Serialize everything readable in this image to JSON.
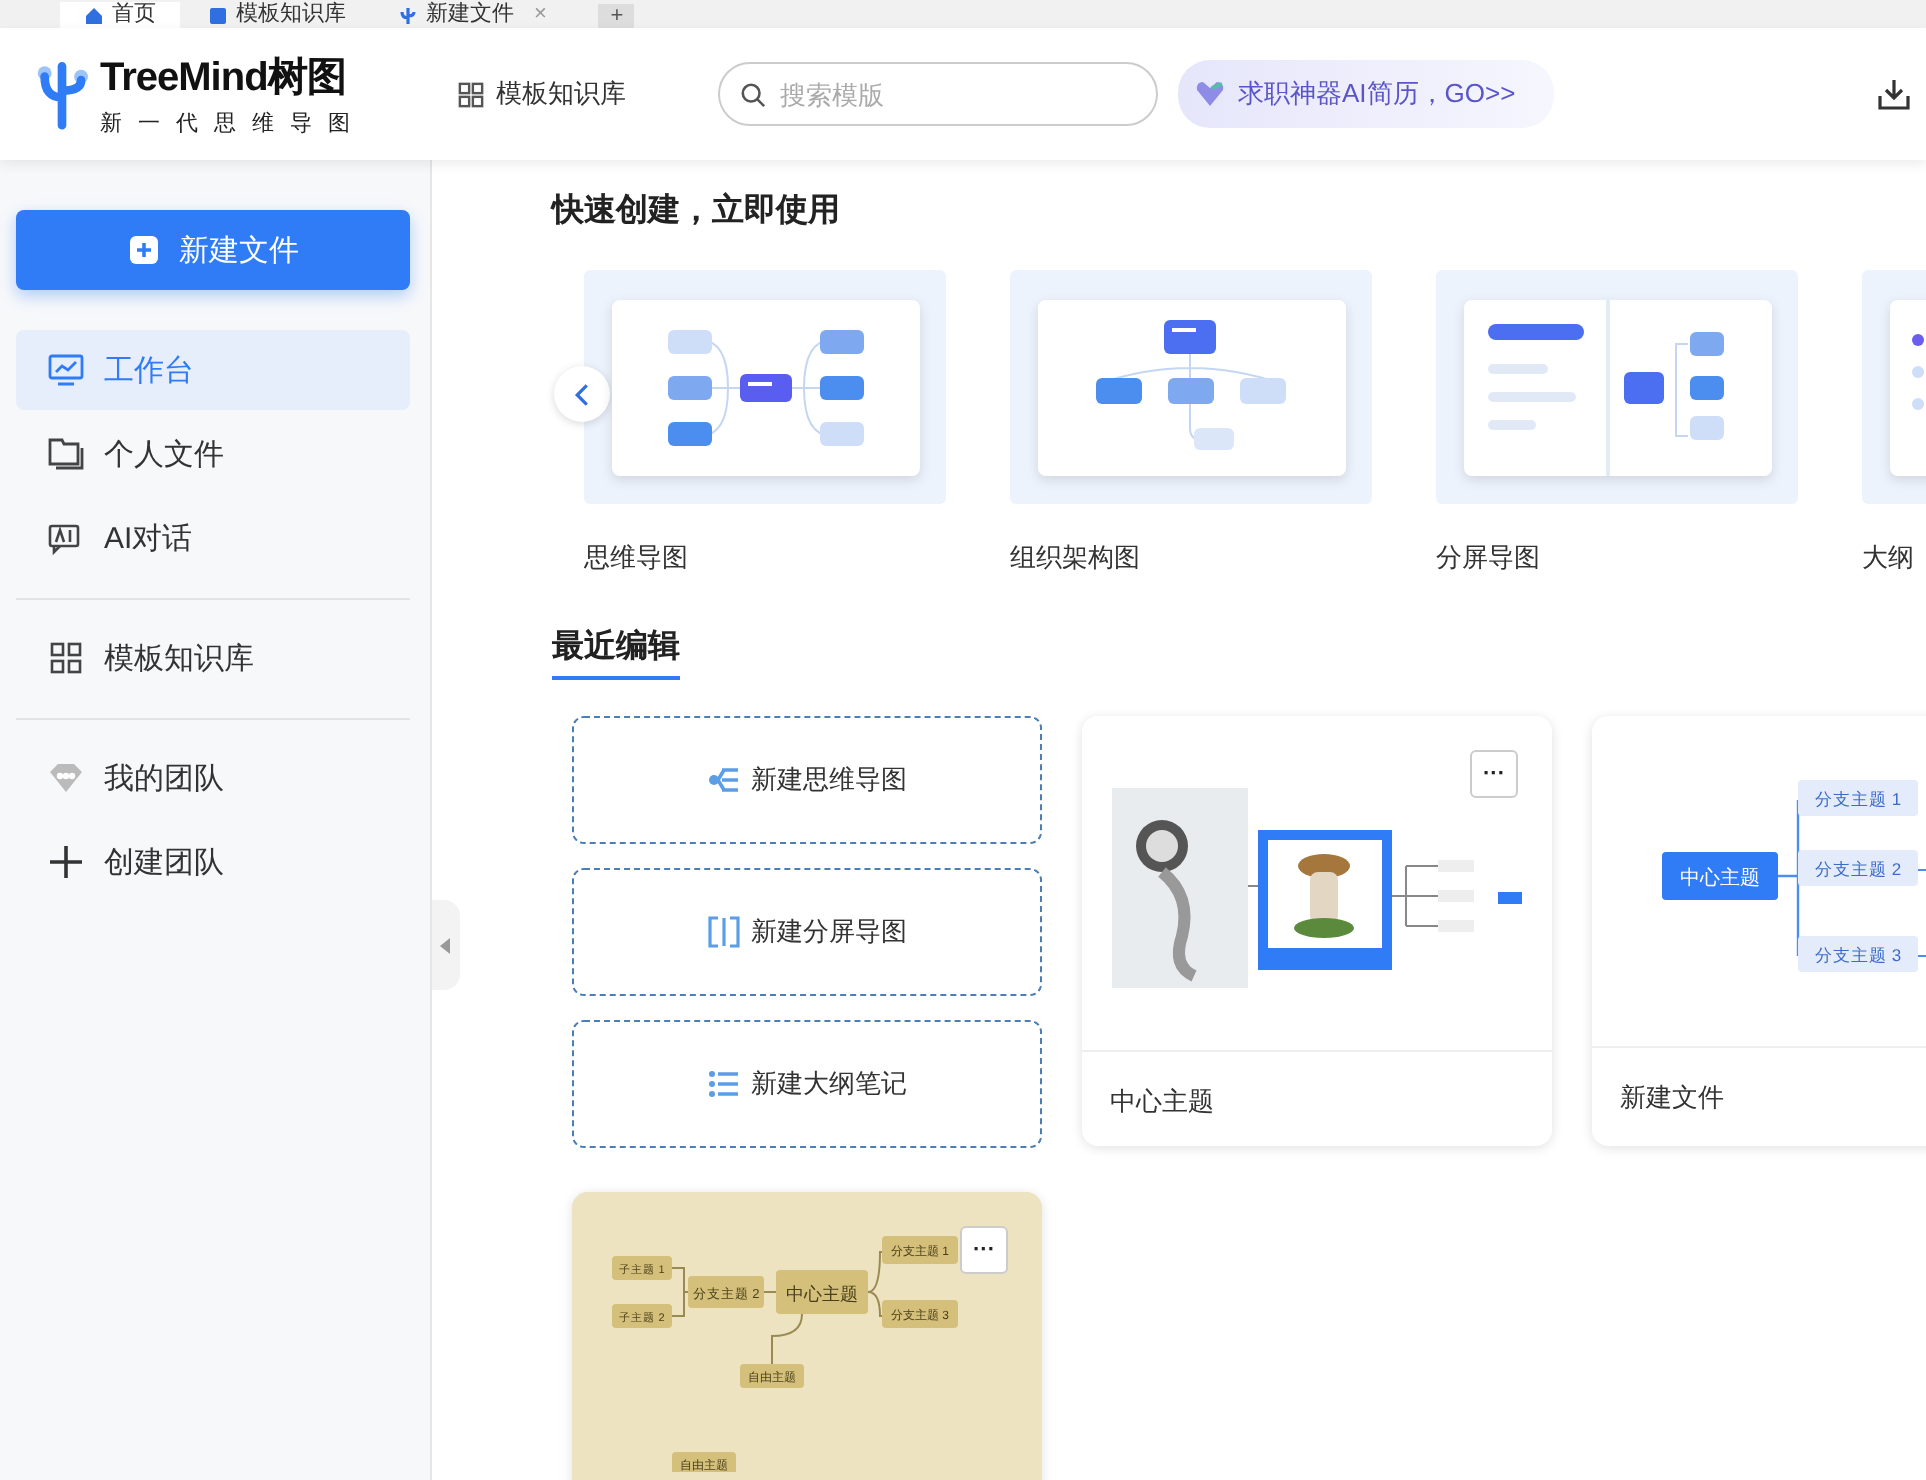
{
  "browser_tabs": [
    {
      "label": "首页",
      "selected": true,
      "kind": "home"
    },
    {
      "label": "模板知识库",
      "selected": false,
      "kind": "library"
    },
    {
      "label": "新建文件",
      "selected": false,
      "kind": "file",
      "close": "×"
    }
  ],
  "new_tab": "+",
  "header": {
    "logo": "TreeMind树图",
    "tagline": "新一代思维导图",
    "nav_link": "模板知识库",
    "search": {
      "placeholder": "搜索模版"
    },
    "promo": "求职神器AI简历，GO>>"
  },
  "sidebar": {
    "new_button": "新建文件",
    "groups": [
      [
        {
          "label": "工作台",
          "kind": "workbench",
          "selected": true
        },
        {
          "label": "个人文件",
          "kind": "folder",
          "selected": false
        },
        {
          "label": "AI对话",
          "kind": "ai",
          "selected": false
        }
      ],
      [
        {
          "label": "模板知识库",
          "kind": "grid",
          "selected": false
        }
      ],
      [
        {
          "label": "我的团队",
          "kind": "team",
          "selected": false
        },
        {
          "label": "创建团队",
          "kind": "plus",
          "selected": false
        }
      ]
    ]
  },
  "quick_create": {
    "title": "快速创建，立即使用",
    "templates": [
      {
        "label": "思维导图",
        "kind": "mindmap"
      },
      {
        "label": "组织架构图",
        "kind": "org"
      },
      {
        "label": "分屏导图",
        "kind": "split"
      },
      {
        "label": "大纲",
        "kind": "outline"
      }
    ]
  },
  "recent": {
    "title": "最近编辑",
    "create_buttons": [
      {
        "label": "新建思维导图",
        "kind": "mindmap"
      },
      {
        "label": "新建分屏导图",
        "kind": "split"
      },
      {
        "label": "新建大纲笔记",
        "kind": "outline"
      }
    ],
    "files": [
      {
        "name": "中心主题",
        "kind": "picture",
        "menu": "···"
      },
      {
        "name": "新建文件",
        "kind": "map",
        "center": "中心主题",
        "branches": [
          "分支主题 1",
          "分支主题 2",
          "分支主题 3"
        ]
      },
      {
        "kind": "beige_map",
        "menu": "···",
        "center": "中心主题",
        "left": "分支主题 2",
        "subs": [
          "子主题 1",
          "子主题 2"
        ],
        "right": [
          "分支主题 1",
          "分支主题 3"
        ],
        "free": [
          "自由主题",
          "自由主题"
        ]
      }
    ]
  }
}
